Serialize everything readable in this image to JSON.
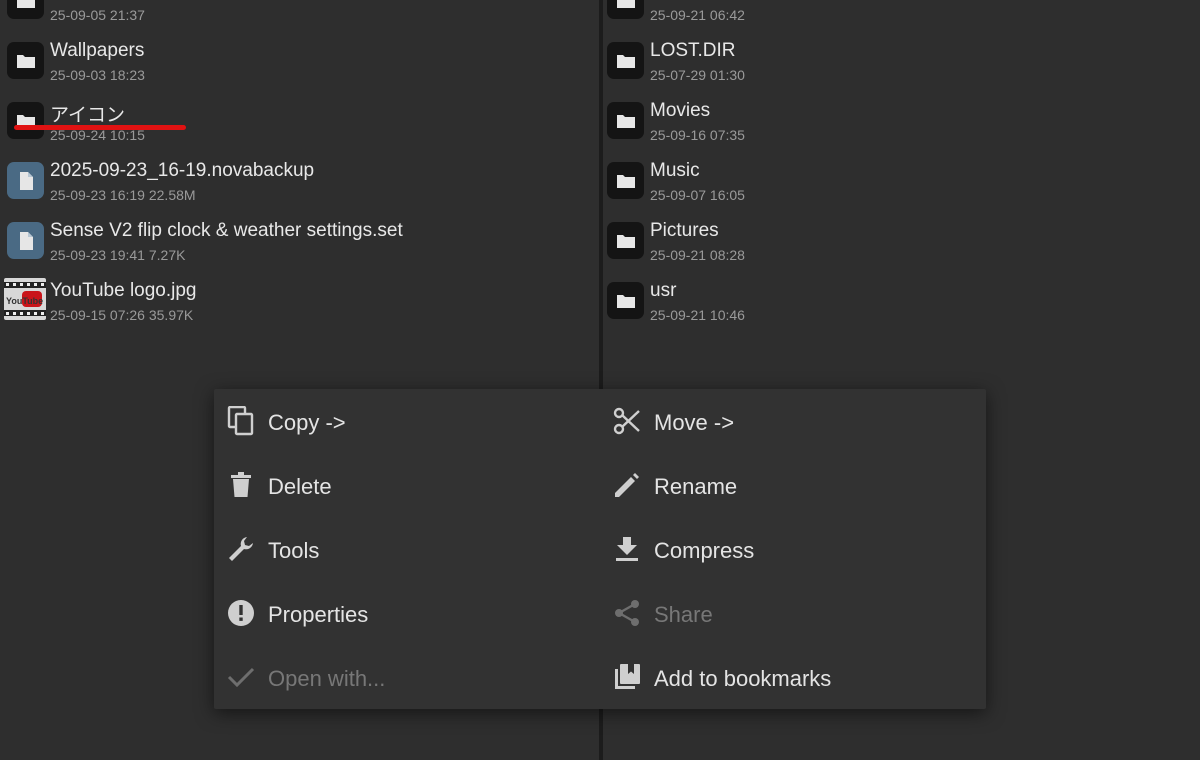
{
  "left_pane": {
    "items": [
      {
        "name": "",
        "meta": "25-09-05 21:37",
        "icon": "folder-icon"
      },
      {
        "name": "Wallpapers",
        "meta": "25-09-03 18:23",
        "icon": "folder-icon"
      },
      {
        "name": "アイコン",
        "meta": "25-09-24 10:15",
        "icon": "folder-icon"
      },
      {
        "name": "2025-09-23_16-19.novabackup",
        "meta": "25-09-23 16:19  22.58M",
        "icon": "file-icon"
      },
      {
        "name": "Sense V2 flip clock & weather settings.set",
        "meta": "25-09-23 19:41  7.27K",
        "icon": "file-icon"
      },
      {
        "name": "YouTube logo.jpg",
        "meta": "25-09-15 07:26  35.97K",
        "icon": "image-thumbnail"
      }
    ],
    "thumb_text": "YouTube"
  },
  "right_pane": {
    "items": [
      {
        "name": "",
        "meta": "25-09-21 06:42",
        "icon": "folder-icon"
      },
      {
        "name": "LOST.DIR",
        "meta": "25-07-29 01:30",
        "icon": "folder-icon"
      },
      {
        "name": "Movies",
        "meta": "25-09-16 07:35",
        "icon": "folder-icon"
      },
      {
        "name": "Music",
        "meta": "25-09-07 16:05",
        "icon": "folder-icon"
      },
      {
        "name": "Pictures",
        "meta": "25-09-21 08:28",
        "icon": "folder-icon"
      },
      {
        "name": "usr",
        "meta": "25-09-21 10:46",
        "icon": "folder-icon"
      }
    ]
  },
  "context_menu": {
    "copy": "Copy ->",
    "move": "Move ->",
    "delete": "Delete",
    "rename": "Rename",
    "tools": "Tools",
    "compress": "Compress",
    "properties": "Properties",
    "share": "Share",
    "open_with": "Open with...",
    "add_bookmarks": "Add to bookmarks"
  },
  "colors": {
    "background": "#2e2e2e",
    "menu_background": "#323232",
    "folder_icon_bg": "#141414",
    "file_icon_bg": "#4a6a84",
    "highlight_underline": "#e01212",
    "disabled_text": "#777777"
  }
}
